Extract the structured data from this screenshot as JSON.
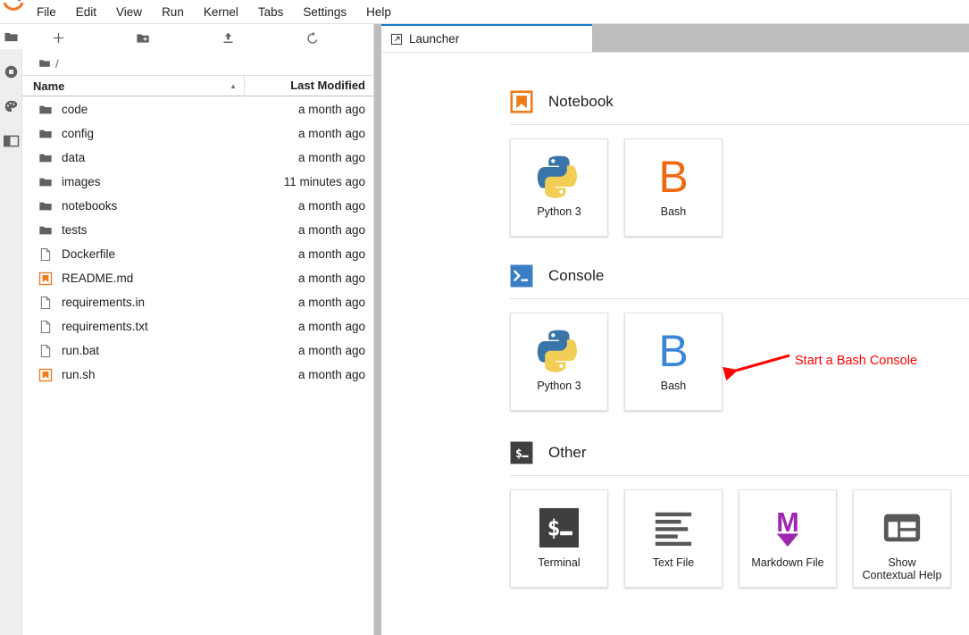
{
  "app": {
    "logo": "jupyter-logo",
    "accent_blue": "#1976d2",
    "orange": "#ee7a1a",
    "annotation_red": "#ff0000"
  },
  "menubar": {
    "items": [
      {
        "label": "File",
        "name": "menu-file"
      },
      {
        "label": "Edit",
        "name": "menu-edit"
      },
      {
        "label": "View",
        "name": "menu-view"
      },
      {
        "label": "Run",
        "name": "menu-run"
      },
      {
        "label": "Kernel",
        "name": "menu-kernel"
      },
      {
        "label": "Tabs",
        "name": "menu-tabs"
      },
      {
        "label": "Settings",
        "name": "menu-settings"
      },
      {
        "label": "Help",
        "name": "menu-help"
      }
    ]
  },
  "activitybar": {
    "items": [
      {
        "icon": "folder-icon",
        "name": "sidebar-item-file-browser",
        "active": true
      },
      {
        "icon": "stop-circle-icon",
        "name": "sidebar-item-running-terminals-kernels",
        "active": false
      },
      {
        "icon": "palette-icon",
        "name": "sidebar-item-extension-manager",
        "active": false
      },
      {
        "icon": "panel-layout-icon",
        "name": "sidebar-item-open-tabs",
        "active": false
      }
    ]
  },
  "filebrowser": {
    "toolbar": [
      {
        "icon": "plus-icon",
        "name": "new-launcher-button"
      },
      {
        "icon": "new-folder-icon",
        "name": "new-folder-button"
      },
      {
        "icon": "upload-icon",
        "name": "upload-files-button"
      },
      {
        "icon": "refresh-icon",
        "name": "refresh-file-list-button"
      }
    ],
    "breadcrumb": {
      "root_icon": "folder-icon",
      "path": "/"
    },
    "columns": {
      "name": "Name",
      "last_modified": "Last Modified"
    },
    "sort_indicator": "▲",
    "rows": [
      {
        "icon": "folder-icon",
        "name": "code",
        "modified": "a month ago"
      },
      {
        "icon": "folder-icon",
        "name": "config",
        "modified": "a month ago"
      },
      {
        "icon": "folder-icon",
        "name": "data",
        "modified": "a month ago"
      },
      {
        "icon": "folder-icon",
        "name": "images",
        "modified": "11 minutes ago"
      },
      {
        "icon": "folder-icon",
        "name": "notebooks",
        "modified": "a month ago"
      },
      {
        "icon": "folder-icon",
        "name": "tests",
        "modified": "a month ago"
      },
      {
        "icon": "file-icon",
        "name": "Dockerfile",
        "modified": "a month ago"
      },
      {
        "icon": "notebook-icon",
        "name": "README.md",
        "modified": "a month ago"
      },
      {
        "icon": "file-icon",
        "name": "requirements.in",
        "modified": "a month ago"
      },
      {
        "icon": "file-icon",
        "name": "requirements.txt",
        "modified": "a month ago"
      },
      {
        "icon": "file-icon",
        "name": "run.bat",
        "modified": "a month ago"
      },
      {
        "icon": "notebook-icon",
        "name": "run.sh",
        "modified": "a month ago"
      }
    ]
  },
  "dock": {
    "tabs": [
      {
        "label": "Launcher",
        "icon": "launcher-icon",
        "active": true
      }
    ]
  },
  "launcher": {
    "sections": [
      {
        "title": "Notebook",
        "icon": "notebook-icon",
        "cards": [
          {
            "label": "Python 3",
            "icon": "python-logo-icon"
          },
          {
            "label": "Bash",
            "icon": "bash-b-orange-icon"
          }
        ]
      },
      {
        "title": "Console",
        "icon": "console-prompt-icon",
        "cards": [
          {
            "label": "Python 3",
            "icon": "python-logo-icon"
          },
          {
            "label": "Bash",
            "icon": "bash-b-blue-icon"
          }
        ]
      },
      {
        "title": "Other",
        "icon": "terminal-prompt-icon",
        "cards": [
          {
            "label": "Terminal",
            "icon": "terminal-icon"
          },
          {
            "label": "Text File",
            "icon": "text-file-icon"
          },
          {
            "label": "Markdown File",
            "icon": "markdown-icon"
          },
          {
            "label": "Show\nContextual Help",
            "icon": "contextual-help-icon"
          }
        ]
      }
    ]
  },
  "annotation": {
    "text": "Start a Bash Console",
    "color": "#ff0000"
  }
}
